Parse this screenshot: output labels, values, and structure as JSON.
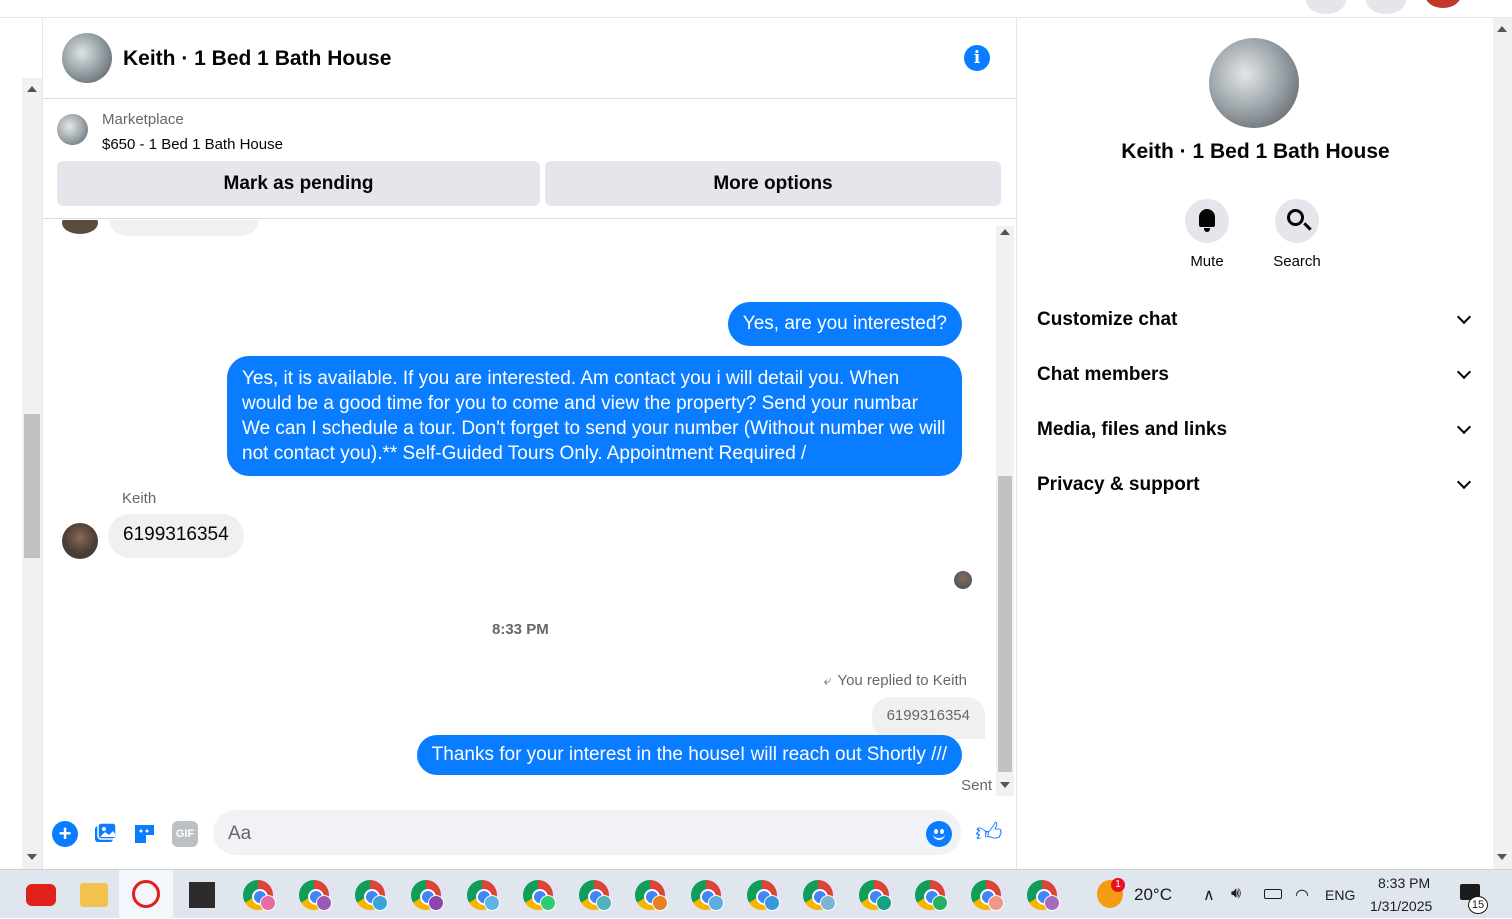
{
  "header": {
    "title": "Keith · 1 Bed 1 Bath House",
    "info_icon": "info-icon"
  },
  "marketplace": {
    "label": "Marketplace",
    "item": "$650 - 1 Bed 1 Bath House",
    "mark_pending": "Mark as pending",
    "more_options": "More options"
  },
  "messages": {
    "out1": "Yes, are you interested?",
    "out2": "Yes, it is available. If you are interested.  Am contact you i will detail you.  When would be a good time for you to come and view the property? Send your numbar We can I schedule a tour.  Don't forget to send your number (Without number we will not contact you).** Self-Guided Tours Only. Appointment Required /",
    "sender": "Keith",
    "in1": "6199316354",
    "timestamp": "8:33 PM",
    "replied_to": "You replied to Keith",
    "quoted": "6199316354",
    "out3": "Thanks for your interest in the houseI will reach out Shortly ///",
    "status": "Sent"
  },
  "composer": {
    "placeholder": "Aa",
    "gif_label": "GIF",
    "icons": [
      "plus-icon",
      "photo-icon",
      "sticker-icon",
      "gif-icon",
      "emoji-icon",
      "like-icon"
    ]
  },
  "right_panel": {
    "title": "Keith · 1 Bed 1 Bath House",
    "mute": "Mute",
    "search": "Search",
    "sections": [
      "Customize chat",
      "Chat members",
      "Media, files and links",
      "Privacy & support"
    ]
  },
  "taskbar": {
    "weather": "20°C",
    "weather_badge": "1",
    "language": "ENG",
    "time": "8:33 PM",
    "date": "1/31/2025",
    "notifications": "15",
    "chrome_badge_colors": [
      "#e86aa6",
      "#9b59b6",
      "#3aa3d8",
      "#8e44ad",
      "#5bb5e6",
      "#2ecc71",
      "#4fb3bf",
      "#e67e22",
      "#5dade2",
      "#3498db",
      "#7fb3d5",
      "#16a085",
      "#27ae60",
      "#f1948a",
      "#a569bd"
    ]
  },
  "colors": {
    "messenger_blue": "#0a7cff",
    "bubble_gray": "#f0f0f0",
    "button_gray": "#e4e6eb"
  }
}
